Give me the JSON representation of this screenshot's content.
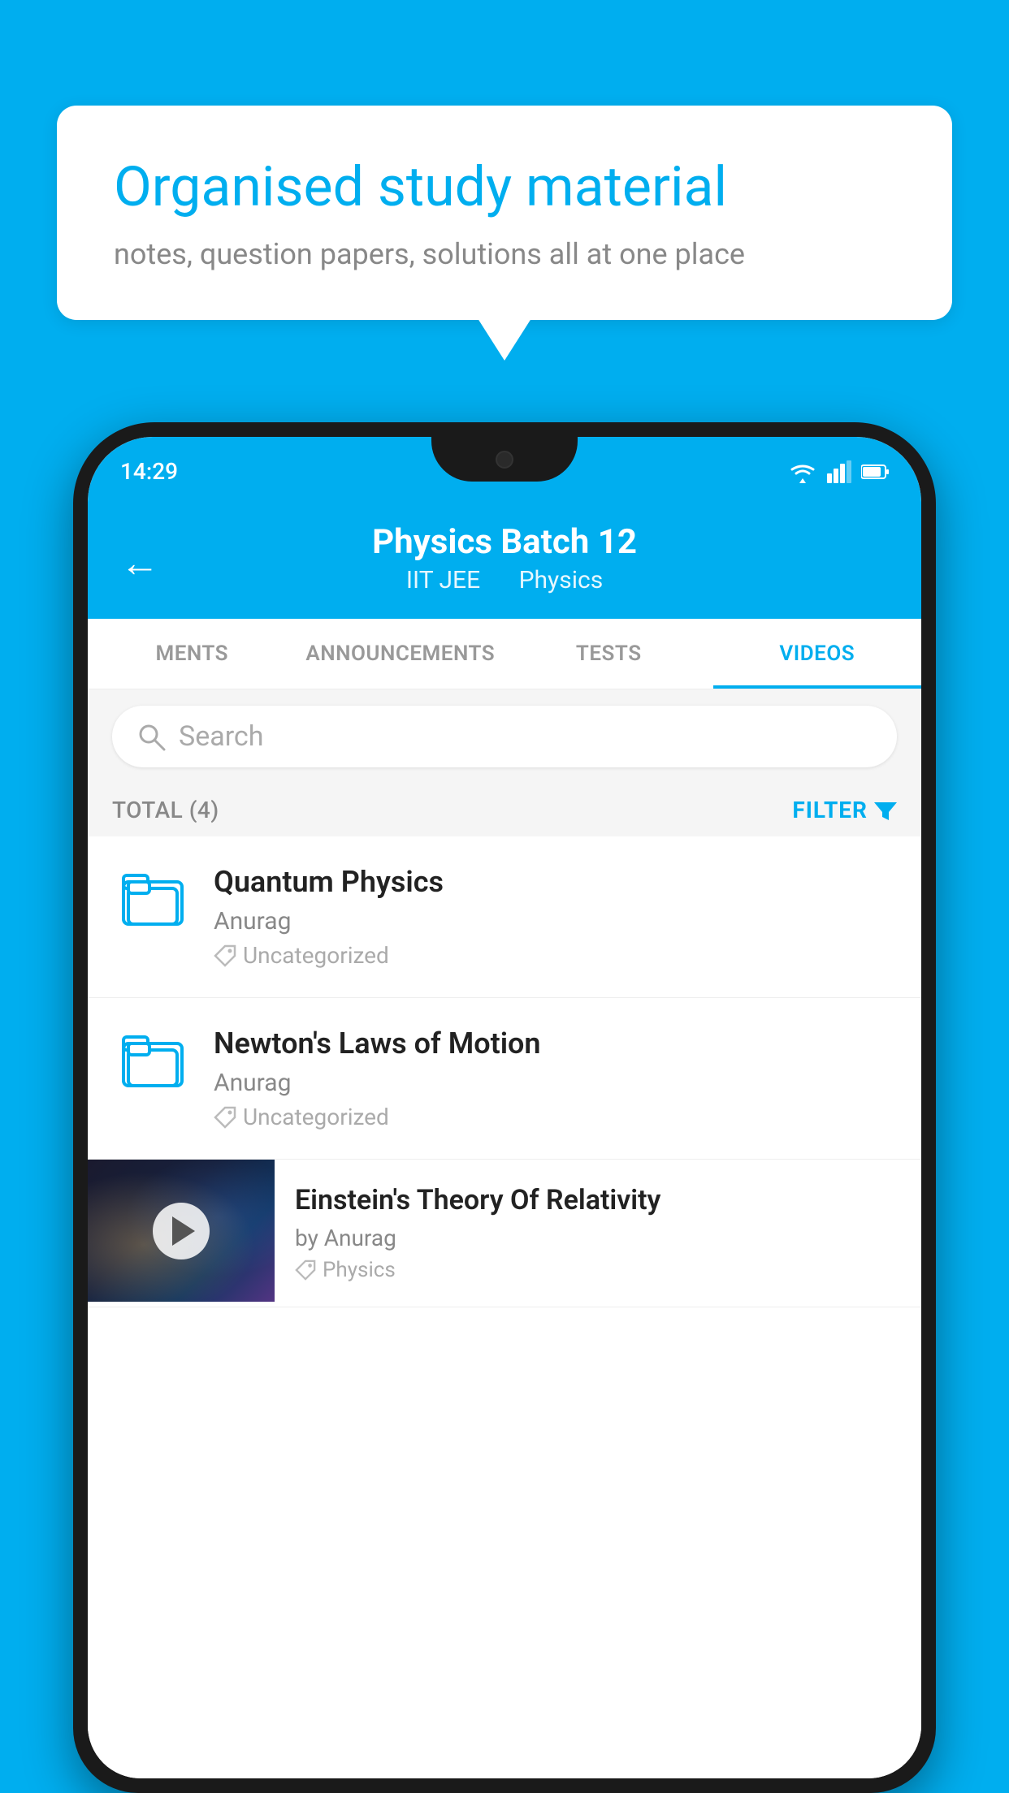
{
  "background_color": "#00AEEF",
  "speech_bubble": {
    "title": "Organised study material",
    "subtitle": "notes, question papers, solutions all at one place"
  },
  "status_bar": {
    "time": "14:29",
    "icons": [
      "wifi",
      "signal",
      "battery"
    ]
  },
  "header": {
    "back_label": "←",
    "title": "Physics Batch 12",
    "subtitle_part1": "IIT JEE",
    "subtitle_part2": "Physics"
  },
  "tabs": [
    {
      "label": "MENTS",
      "active": false
    },
    {
      "label": "ANNOUNCEMENTS",
      "active": false
    },
    {
      "label": "TESTS",
      "active": false
    },
    {
      "label": "VIDEOS",
      "active": true
    }
  ],
  "search": {
    "placeholder": "Search"
  },
  "filter_bar": {
    "total_label": "TOTAL (4)",
    "filter_label": "FILTER"
  },
  "videos": [
    {
      "id": 1,
      "title": "Quantum Physics",
      "author": "Anurag",
      "tag": "Uncategorized",
      "type": "folder",
      "thumbnail": null
    },
    {
      "id": 2,
      "title": "Newton's Laws of Motion",
      "author": "Anurag",
      "tag": "Uncategorized",
      "type": "folder",
      "thumbnail": null
    },
    {
      "id": 3,
      "title": "Einstein's Theory Of Relativity",
      "author": "by Anurag",
      "tag": "Physics",
      "type": "video",
      "thumbnail": true
    }
  ]
}
